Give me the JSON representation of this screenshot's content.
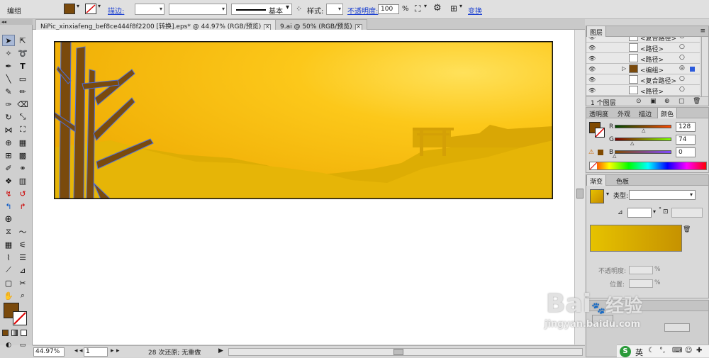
{
  "control_bar": {
    "object_type": "编组",
    "stroke_label": "描边:",
    "stroke_style": "基本",
    "style_label": "样式:",
    "opacity_label": "不透明度:",
    "opacity_value": "100",
    "opacity_unit": "%",
    "transform_label": "变换",
    "fill_color": "#7a4a0c"
  },
  "tabs": [
    {
      "label": "NiPic_xinxiafeng_bef8ce444f8f2200  [转换].eps* @ 44.97% (RGB/预览)",
      "close": "✕"
    },
    {
      "label": "9.ai @ 50% (RGB/预览)",
      "close": "✕"
    }
  ],
  "status_bar": {
    "zoom": "44.97%",
    "page": "1",
    "history": "28 次还原; 无重做"
  },
  "layers_panel": {
    "title": "图层",
    "items": [
      {
        "label": "<复合路径>",
        "toggle": "○"
      },
      {
        "label": "<路径>",
        "toggle": "○"
      },
      {
        "label": "<路径>",
        "toggle": "○"
      },
      {
        "label": "<编组>",
        "toggle": "◎"
      },
      {
        "label": "<复合路径>",
        "toggle": "○"
      },
      {
        "label": "<路径>",
        "toggle": "○"
      }
    ],
    "footer": "1 个图层"
  },
  "color_panel": {
    "tabs": [
      "透明度",
      "外观",
      "描边",
      "颜色"
    ],
    "r_label": "R",
    "g_label": "G",
    "b_label": "B",
    "r": "128",
    "g": "74",
    "b": "0",
    "fill_color": "#804a00"
  },
  "gradient_panel": {
    "tabs": [
      "渐变",
      "色板"
    ],
    "type_label": "类型:",
    "opacity_label": "不透明度:",
    "position_label": "位置:",
    "opacity_unit": "%",
    "position_unit": "%"
  },
  "watermark": {
    "brand": "Bai",
    "brand2": "经验",
    "url": "jingyan.baidu.com"
  },
  "taskbar": {
    "ime": "英"
  }
}
